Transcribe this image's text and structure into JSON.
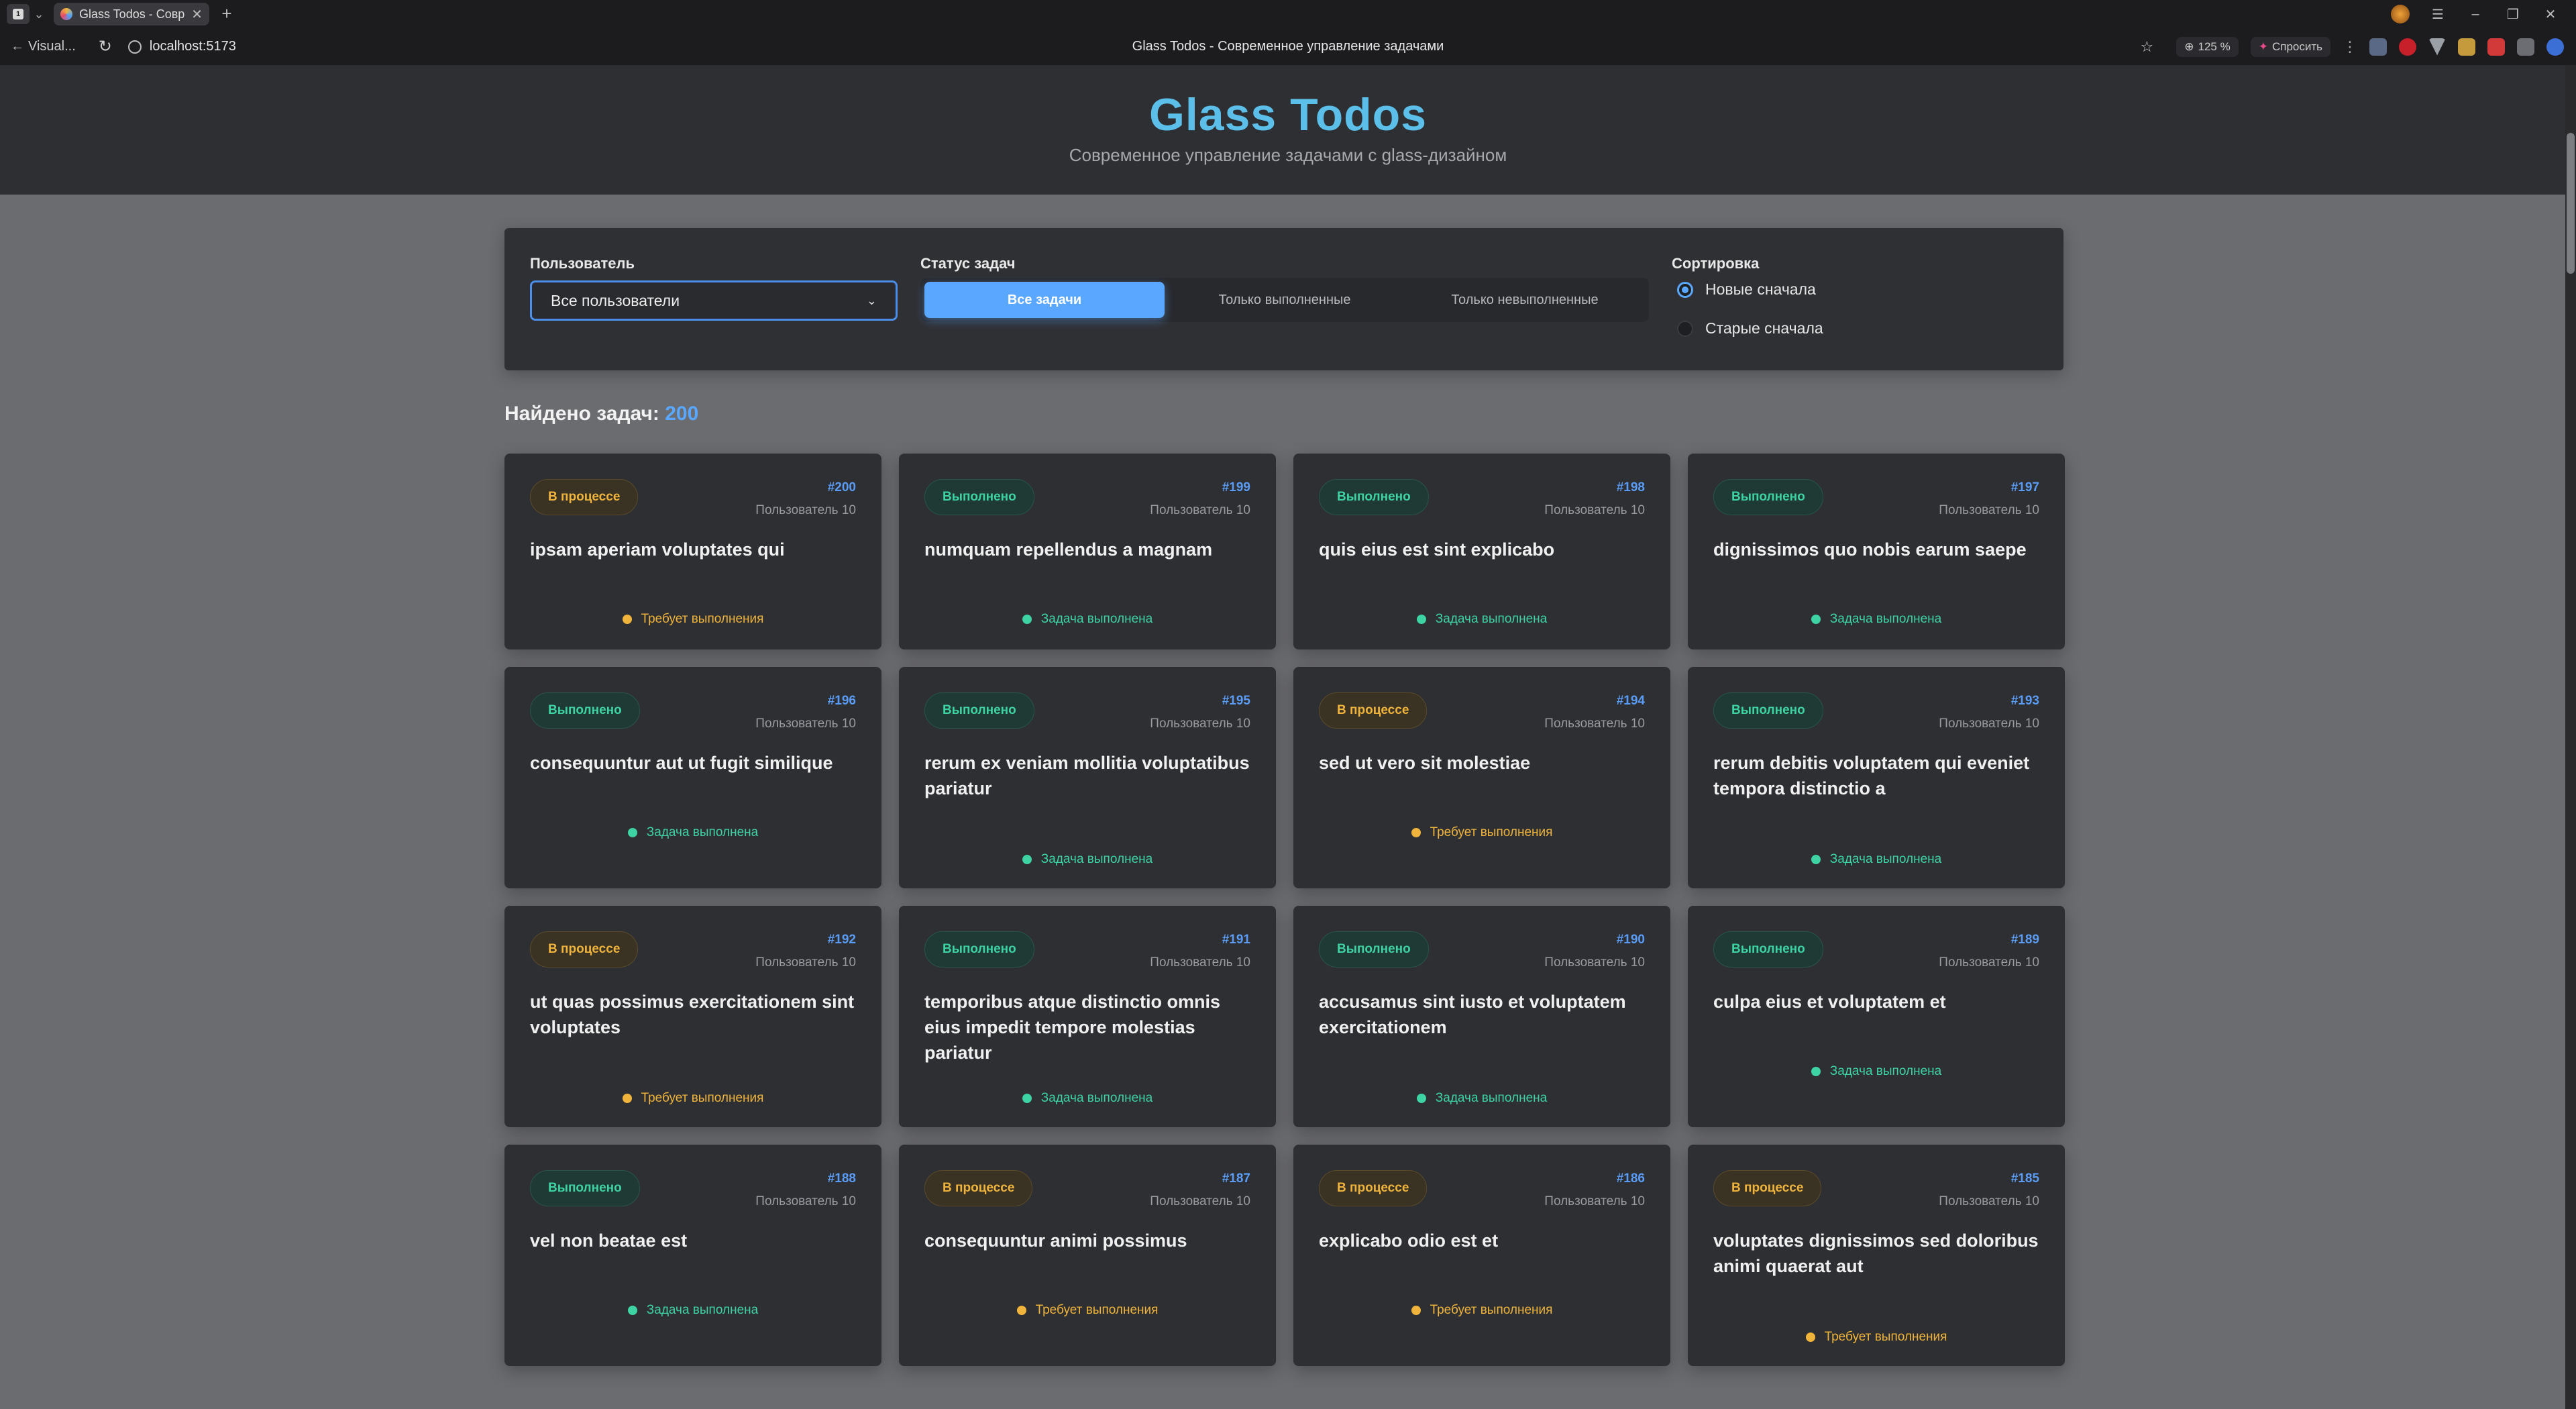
{
  "browser": {
    "tab_title": "Glass Todos - Современ",
    "tab_close": "✕",
    "new_tab": "+",
    "back_label": "Visual...",
    "url": "localhost:5173",
    "page_title": "Glass Todos - Современное управление задачами",
    "zoom": "125 %",
    "ask_label": "Спросить"
  },
  "header": {
    "title": "Glass Todos",
    "subtitle": "Современное управление задачами с glass-дизайном"
  },
  "filters": {
    "user_label": "Пользователь",
    "user_value": "Все пользователи",
    "status_label": "Статус задач",
    "status_options": [
      "Все задачи",
      "Только выполненные",
      "Только невыполненные"
    ],
    "status_selected": "Все задачи",
    "sort_label": "Сортировка",
    "sort_options": [
      "Новые сначала",
      "Старые сначала"
    ],
    "sort_selected": "Новые сначала"
  },
  "summary": {
    "label": "Найдено задач:",
    "count": "200"
  },
  "colors": {
    "accent": "#5aa7ff",
    "title": "#5bbfe9",
    "done": "#3ed3a3",
    "in_progress": "#f0b43c"
  },
  "cards": [
    {
      "id": "#200",
      "user": "Пользователь 10",
      "title": "ipsam aperiam voluptates qui",
      "badge": "В процессе",
      "status": "Требует выполнения",
      "done": false
    },
    {
      "id": "#199",
      "user": "Пользователь 10",
      "title": "numquam repellendus a magnam",
      "badge": "Выполнено",
      "status": "Задача выполнена",
      "done": true
    },
    {
      "id": "#198",
      "user": "Пользователь 10",
      "title": "quis eius est sint explicabo",
      "badge": "Выполнено",
      "status": "Задача выполнена",
      "done": true
    },
    {
      "id": "#197",
      "user": "Пользователь 10",
      "title": "dignissimos quo nobis earum saepe",
      "badge": "Выполнено",
      "status": "Задача выполнена",
      "done": true
    },
    {
      "id": "#196",
      "user": "Пользователь 10",
      "title": "consequuntur aut ut fugit similique",
      "badge": "Выполнено",
      "status": "Задача выполнена",
      "done": true
    },
    {
      "id": "#195",
      "user": "Пользователь 10",
      "title": "rerum ex veniam mollitia voluptatibus pariatur",
      "badge": "Выполнено",
      "status": "Задача выполнена",
      "done": true
    },
    {
      "id": "#194",
      "user": "Пользователь 10",
      "title": "sed ut vero sit molestiae",
      "badge": "В процессе",
      "status": "Требует выполнения",
      "done": false
    },
    {
      "id": "#193",
      "user": "Пользователь 10",
      "title": "rerum debitis voluptatem qui eveniet tempora distinctio a",
      "badge": "Выполнено",
      "status": "Задача выполнена",
      "done": true
    },
    {
      "id": "#192",
      "user": "Пользователь 10",
      "title": "ut quas possimus exercitationem sint voluptates",
      "badge": "В процессе",
      "status": "Требует выполнения",
      "done": false
    },
    {
      "id": "#191",
      "user": "Пользователь 10",
      "title": "temporibus atque distinctio omnis eius impedit tempore molestias pariatur",
      "badge": "Выполнено",
      "status": "Задача выполнена",
      "done": true
    },
    {
      "id": "#190",
      "user": "Пользователь 10",
      "title": "accusamus sint iusto et voluptatem exercitationem",
      "badge": "Выполнено",
      "status": "Задача выполнена",
      "done": true
    },
    {
      "id": "#189",
      "user": "Пользователь 10",
      "title": "culpa eius et voluptatem et",
      "badge": "Выполнено",
      "status": "Задача выполнена",
      "done": true
    },
    {
      "id": "#188",
      "user": "Пользователь 10",
      "title": "vel non beatae est",
      "badge": "Выполнено",
      "status": "Задача выполнена",
      "done": true
    },
    {
      "id": "#187",
      "user": "Пользователь 10",
      "title": "consequuntur animi possimus",
      "badge": "В процессе",
      "status": "Требует выполнения",
      "done": false
    },
    {
      "id": "#186",
      "user": "Пользователь 10",
      "title": "explicabo odio est et",
      "badge": "В процессе",
      "status": "Требует выполнения",
      "done": false
    },
    {
      "id": "#185",
      "user": "Пользователь 10",
      "title": "voluptates dignissimos sed doloribus animi quaerat aut",
      "badge": "В процессе",
      "status": "Требует выполнения",
      "done": false
    }
  ]
}
